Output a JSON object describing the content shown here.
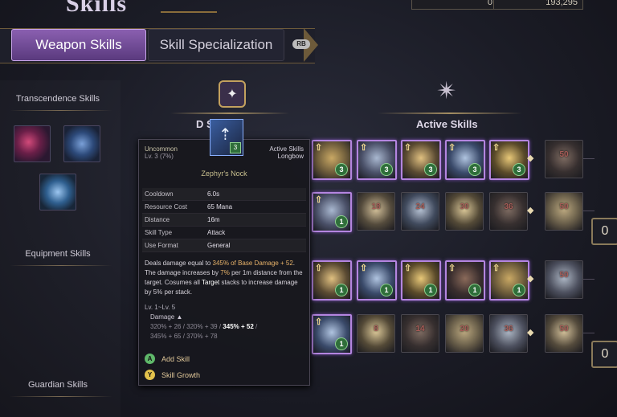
{
  "header": {
    "title": "Skills",
    "currency": [
      "0",
      "193,295"
    ]
  },
  "tabs": [
    {
      "label": "Weapon Skills",
      "active": true
    },
    {
      "label": "Skill Specialization",
      "active": false
    }
  ],
  "tab_hint": "RB",
  "sidebar": {
    "sections": [
      "Transcendence Skills",
      "Equipment Skills",
      "Guardian Skills"
    ]
  },
  "sections": {
    "defense": "D    Skills",
    "active": "Active Skills"
  },
  "tiles": {
    "row1": [
      {
        "state": "owned",
        "level": "3"
      },
      {
        "state": "owned",
        "level": "3"
      },
      {
        "state": "owned",
        "level": "3"
      },
      {
        "state": "owned",
        "level": "3"
      },
      {
        "state": "owned",
        "level": "3"
      },
      {
        "state": "locked",
        "req": "50"
      }
    ],
    "row2": [
      {
        "state": "owned",
        "level": "1"
      },
      {
        "state": "locked",
        "req": "18"
      },
      {
        "state": "locked",
        "req": "24"
      },
      {
        "state": "locked",
        "req": "30"
      },
      {
        "state": "locked",
        "req": "36"
      },
      {
        "state": "locked",
        "req": "50"
      }
    ],
    "row3": [
      {
        "state": "owned",
        "level": "1"
      },
      {
        "state": "owned",
        "level": "1"
      },
      {
        "state": "owned",
        "level": "1"
      },
      {
        "state": "owned",
        "level": "1"
      },
      {
        "state": "owned",
        "level": "1"
      },
      {
        "state": "locked",
        "req": "50"
      }
    ],
    "row4": [
      {
        "state": "owned",
        "level": "1"
      },
      {
        "state": "locked",
        "req": "8"
      },
      {
        "state": "locked",
        "req": "14"
      },
      {
        "state": "locked",
        "req": "20"
      },
      {
        "state": "locked",
        "req": "36"
      },
      {
        "state": "locked",
        "req": "50"
      }
    ]
  },
  "side_buttons": [
    "0",
    "0"
  ],
  "tooltip": {
    "rarity": "Uncommon",
    "level": "Lv. 3 (7%)",
    "category": "Active Skills",
    "weapon": "Longbow",
    "icon_level": "3",
    "name": "Zephyr's Nock",
    "stats": [
      {
        "k": "Cooldown",
        "v": "6.0s"
      },
      {
        "k": "Resource Cost",
        "v": "65  Mana"
      },
      {
        "k": "Distance",
        "v": "16m"
      },
      {
        "k": "Skill Type",
        "v": "Attack"
      },
      {
        "k": "Use Format",
        "v": "General"
      }
    ],
    "desc": {
      "a": "Deals damage equal to ",
      "b": "345% of Base Damage + 52",
      "c": ". The damage increases by ",
      "d": "7%",
      "e": " per 1m distance from the target. Cosumes all ",
      "f": "Target",
      "g": " stacks to increase damage by 5% per stack."
    },
    "level_range": "Lv. 1~Lv. 5",
    "damage_label": "Damage ▲",
    "formula": {
      "p1": "320% + 26 / 320% + 39 / ",
      "p2": "345% + 52",
      "p3": " /",
      "p4": "345% + 65 / 370% + 78"
    },
    "actions": [
      {
        "btn": "A",
        "label": "Add Skill",
        "color": "#5fb86a"
      },
      {
        "btn": "Y",
        "label": "Skill Growth",
        "color": "#e3c24c"
      }
    ]
  }
}
